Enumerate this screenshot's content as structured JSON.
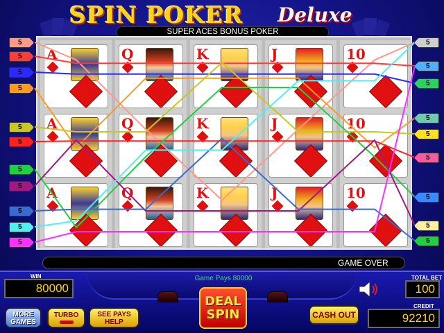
{
  "title": {
    "main": "SPIN POKER",
    "suffix": "Deluxe"
  },
  "game_name": "SUPER ACES BONUS POKER",
  "reels": [
    {
      "rank": "A",
      "face": "ace"
    },
    {
      "rank": "Q",
      "face": "queen"
    },
    {
      "rank": "K",
      "face": "king"
    },
    {
      "rank": "J",
      "face": "jack"
    },
    {
      "rank": "10",
      "face": "none"
    }
  ],
  "left_line_tags": [
    {
      "label": "5",
      "color": "#ff9a8a"
    },
    {
      "label": "5",
      "color": "#ff3a3a"
    },
    {
      "label": "5",
      "color": "#2a2aff"
    },
    {
      "label": "5",
      "color": "#ff9a20"
    },
    {
      "label": "5",
      "color": "#c8c820"
    },
    {
      "label": "5",
      "color": "#ff2020"
    },
    {
      "label": "5",
      "color": "#20d040"
    },
    {
      "label": "5",
      "color": "#a01880"
    },
    {
      "label": "5",
      "color": "#3a6ad0"
    },
    {
      "label": "5",
      "color": "#50f0f0"
    },
    {
      "label": "5",
      "color": "#ff30ff"
    }
  ],
  "right_line_tags": [
    {
      "label": "5",
      "color": "#cfcfcf"
    },
    {
      "label": "5",
      "color": "#50b0ff"
    },
    {
      "label": "5",
      "color": "#30d060"
    },
    {
      "label": "5",
      "color": "#70c8b0"
    },
    {
      "label": "5",
      "color": "#ffe020"
    },
    {
      "label": "5",
      "color": "#ff5aa0"
    },
    {
      "label": "5",
      "color": "#3a8aff"
    },
    {
      "label": "5",
      "color": "#fff0a0"
    },
    {
      "label": "5",
      "color": "#20d040"
    }
  ],
  "status": {
    "message": "GAME OVER"
  },
  "game_pays": "Game Pays 80000",
  "meters": {
    "win_label": "WIN",
    "win_value": "80000",
    "total_bet_label": "TOTAL BET",
    "total_bet_value": "100",
    "credit_label": "CREDIT",
    "credit_value": "92210"
  },
  "buttons": {
    "more_games": "MORE GAMES",
    "turbo": "TURBO",
    "see_pays": "SEE PAYS HELP",
    "deal_spin": "DEAL SPIN",
    "cash_out": "CASH OUT"
  },
  "icons": {
    "sound": "speaker-icon"
  }
}
